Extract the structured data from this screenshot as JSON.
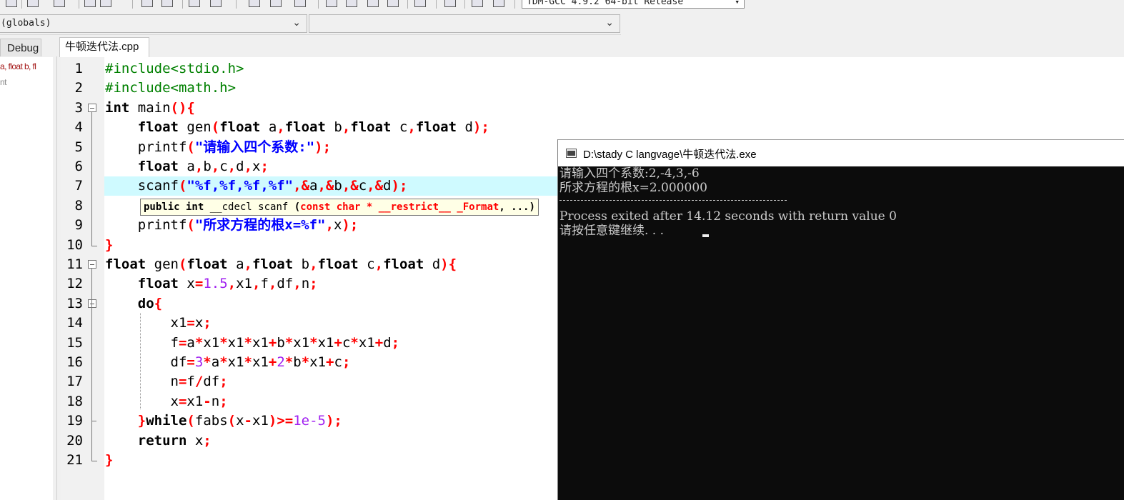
{
  "toolbar": {
    "compiler": "TDM-GCC 4.9.2 64-bit Release",
    "icons": [
      "new-file-icon",
      "open-icon",
      "save-icon",
      "undo-icon",
      "redo-icon",
      "find-icon",
      "replace-icon",
      "goto-icon",
      "indent-icon",
      "compile-icon",
      "run-icon",
      "compile-run-icon",
      "rebuild-icon",
      "debug-icon",
      "grid-icon",
      "window-icon",
      "project-icon",
      "class-icon",
      "check-icon",
      "close-icon",
      "chart-icon",
      "profile-icon"
    ]
  },
  "scope_bar": {
    "left_value": "(globals)",
    "right_value": ""
  },
  "left_panel": {
    "tab_label": "Debug",
    "items": [
      {
        "text": "a, float b, fl",
        "color": "#a31515"
      },
      {
        "text": "nt",
        "color": "#8a8a8a"
      }
    ]
  },
  "editor": {
    "tab_label": "牛顿迭代法.cpp",
    "current_line": 7,
    "lines": [
      [
        {
          "t": "#include<stdio.h>",
          "c": "pp"
        }
      ],
      [
        {
          "t": "#include<math.h>",
          "c": "pp"
        }
      ],
      [
        {
          "t": "int",
          "c": "kw"
        },
        {
          "t": " main"
        },
        {
          "t": "(){",
          "c": "sym"
        }
      ],
      [
        {
          "t": "    "
        },
        {
          "t": "float",
          "c": "kw"
        },
        {
          "t": " gen"
        },
        {
          "t": "(",
          "c": "sym"
        },
        {
          "t": "float",
          "c": "kw"
        },
        {
          "t": " a"
        },
        {
          "t": ",",
          "c": "sym"
        },
        {
          "t": "float",
          "c": "kw"
        },
        {
          "t": " b"
        },
        {
          "t": ",",
          "c": "sym"
        },
        {
          "t": "float",
          "c": "kw"
        },
        {
          "t": " c"
        },
        {
          "t": ",",
          "c": "sym"
        },
        {
          "t": "float",
          "c": "kw"
        },
        {
          "t": " d"
        },
        {
          "t": ");",
          "c": "sym"
        }
      ],
      [
        {
          "t": "    printf"
        },
        {
          "t": "(",
          "c": "sym"
        },
        {
          "t": "\"请输入四个系数:\"",
          "c": "str"
        },
        {
          "t": ");",
          "c": "sym"
        }
      ],
      [
        {
          "t": "    "
        },
        {
          "t": "float",
          "c": "kw"
        },
        {
          "t": " a"
        },
        {
          "t": ",",
          "c": "sym"
        },
        {
          "t": "b"
        },
        {
          "t": ",",
          "c": "sym"
        },
        {
          "t": "c"
        },
        {
          "t": ",",
          "c": "sym"
        },
        {
          "t": "d"
        },
        {
          "t": ",",
          "c": "sym"
        },
        {
          "t": "x"
        },
        {
          "t": ";",
          "c": "sym"
        }
      ],
      [
        {
          "t": "    scanf"
        },
        {
          "t": "(",
          "c": "sym"
        },
        {
          "t": "\"%f,%f,%f,%f\"",
          "c": "str"
        },
        {
          "t": ",&",
          "c": "sym"
        },
        {
          "t": "a"
        },
        {
          "t": ",&",
          "c": "sym"
        },
        {
          "t": "b"
        },
        {
          "t": ",&",
          "c": "sym"
        },
        {
          "t": "c"
        },
        {
          "t": ",&",
          "c": "sym"
        },
        {
          "t": "d"
        },
        {
          "t": ");",
          "c": "sym"
        }
      ],
      [],
      [
        {
          "t": "    printf"
        },
        {
          "t": "(",
          "c": "sym"
        },
        {
          "t": "\"所求方程的根x=%f\"",
          "c": "str"
        },
        {
          "t": ",",
          "c": "sym"
        },
        {
          "t": "x"
        },
        {
          "t": ");",
          "c": "sym"
        }
      ],
      [
        {
          "t": "}",
          "c": "sym"
        }
      ],
      [
        {
          "t": "float",
          "c": "kw"
        },
        {
          "t": " gen"
        },
        {
          "t": "(",
          "c": "sym"
        },
        {
          "t": "float",
          "c": "kw"
        },
        {
          "t": " a"
        },
        {
          "t": ",",
          "c": "sym"
        },
        {
          "t": "float",
          "c": "kw"
        },
        {
          "t": " b"
        },
        {
          "t": ",",
          "c": "sym"
        },
        {
          "t": "float",
          "c": "kw"
        },
        {
          "t": " c"
        },
        {
          "t": ",",
          "c": "sym"
        },
        {
          "t": "float",
          "c": "kw"
        },
        {
          "t": " d"
        },
        {
          "t": "){",
          "c": "sym"
        }
      ],
      [
        {
          "t": "    "
        },
        {
          "t": "float",
          "c": "kw"
        },
        {
          "t": " x"
        },
        {
          "t": "=",
          "c": "sym"
        },
        {
          "t": "1.5",
          "c": "num"
        },
        {
          "t": ",",
          "c": "sym"
        },
        {
          "t": "x1"
        },
        {
          "t": ",",
          "c": "sym"
        },
        {
          "t": "f"
        },
        {
          "t": ",",
          "c": "sym"
        },
        {
          "t": "df"
        },
        {
          "t": ",",
          "c": "sym"
        },
        {
          "t": "n"
        },
        {
          "t": ";",
          "c": "sym"
        }
      ],
      [
        {
          "t": "    "
        },
        {
          "t": "do",
          "c": "kw"
        },
        {
          "t": "{",
          "c": "sym"
        }
      ],
      [
        {
          "t": "        x1"
        },
        {
          "t": "=",
          "c": "sym"
        },
        {
          "t": "x"
        },
        {
          "t": ";",
          "c": "sym"
        }
      ],
      [
        {
          "t": "        f"
        },
        {
          "t": "=",
          "c": "sym"
        },
        {
          "t": "a"
        },
        {
          "t": "*",
          "c": "sym"
        },
        {
          "t": "x1"
        },
        {
          "t": "*",
          "c": "sym"
        },
        {
          "t": "x1"
        },
        {
          "t": "*",
          "c": "sym"
        },
        {
          "t": "x1"
        },
        {
          "t": "+",
          "c": "sym"
        },
        {
          "t": "b"
        },
        {
          "t": "*",
          "c": "sym"
        },
        {
          "t": "x1"
        },
        {
          "t": "*",
          "c": "sym"
        },
        {
          "t": "x1"
        },
        {
          "t": "+",
          "c": "sym"
        },
        {
          "t": "c"
        },
        {
          "t": "*",
          "c": "sym"
        },
        {
          "t": "x1"
        },
        {
          "t": "+",
          "c": "sym"
        },
        {
          "t": "d"
        },
        {
          "t": ";",
          "c": "sym"
        }
      ],
      [
        {
          "t": "        df"
        },
        {
          "t": "=",
          "c": "sym"
        },
        {
          "t": "3",
          "c": "num"
        },
        {
          "t": "*",
          "c": "sym"
        },
        {
          "t": "a"
        },
        {
          "t": "*",
          "c": "sym"
        },
        {
          "t": "x1"
        },
        {
          "t": "*",
          "c": "sym"
        },
        {
          "t": "x1"
        },
        {
          "t": "+",
          "c": "sym"
        },
        {
          "t": "2",
          "c": "num"
        },
        {
          "t": "*",
          "c": "sym"
        },
        {
          "t": "b"
        },
        {
          "t": "*",
          "c": "sym"
        },
        {
          "t": "x1"
        },
        {
          "t": "+",
          "c": "sym"
        },
        {
          "t": "c"
        },
        {
          "t": ";",
          "c": "sym"
        }
      ],
      [
        {
          "t": "        n"
        },
        {
          "t": "=",
          "c": "sym"
        },
        {
          "t": "f"
        },
        {
          "t": "/",
          "c": "sym"
        },
        {
          "t": "df"
        },
        {
          "t": ";",
          "c": "sym"
        }
      ],
      [
        {
          "t": "        x"
        },
        {
          "t": "=",
          "c": "sym"
        },
        {
          "t": "x1"
        },
        {
          "t": "-",
          "c": "sym"
        },
        {
          "t": "n"
        },
        {
          "t": ";",
          "c": "sym"
        }
      ],
      [
        {
          "t": "    "
        },
        {
          "t": "}",
          "c": "sym"
        },
        {
          "t": "while",
          "c": "kw"
        },
        {
          "t": "(",
          "c": "sym"
        },
        {
          "t": "fabs"
        },
        {
          "t": "(",
          "c": "sym"
        },
        {
          "t": "x"
        },
        {
          "t": "-",
          "c": "sym"
        },
        {
          "t": "x1"
        },
        {
          "t": ")>=",
          "c": "sym"
        },
        {
          "t": "1e-5",
          "c": "num"
        },
        {
          "t": ");",
          "c": "sym"
        }
      ],
      [
        {
          "t": "    "
        },
        {
          "t": "return",
          "c": "kw"
        },
        {
          "t": " x"
        },
        {
          "t": ";",
          "c": "sym"
        }
      ],
      [
        {
          "t": "}",
          "c": "sym"
        }
      ]
    ]
  },
  "tooltip": {
    "parts": [
      {
        "t": "public int",
        "c": "tb"
      },
      {
        "t": " __cdecl scanf "
      },
      {
        "t": "(",
        "c": "tb"
      },
      {
        "t": "const char * __restrict__ _Format",
        "c": "tr"
      },
      {
        "t": ", ...)",
        "c": "tb"
      }
    ]
  },
  "console": {
    "title": "D:\\stady C langvage\\牛顿迭代法.exe",
    "lines": [
      "请输入四个系数:2,-4,3,-6",
      "所求方程的根x=2.000000",
      "",
      "Process exited after 14.12 seconds with return value 0",
      "请按任意键继续. . . "
    ]
  }
}
